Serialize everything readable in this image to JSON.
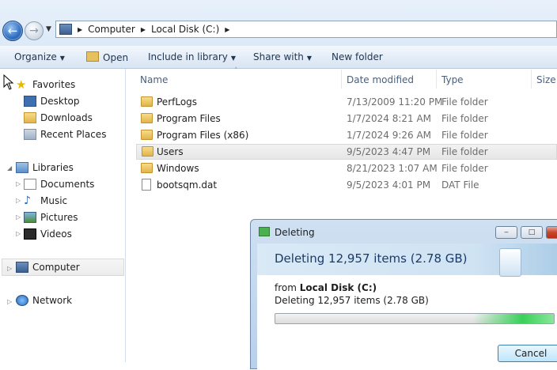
{
  "address_bar": {
    "crumbs": [
      "Computer",
      "Local Disk (C:)"
    ]
  },
  "toolbar": {
    "organize": "Organize",
    "open": "Open",
    "include_in_library": "Include in library",
    "share_with": "Share with",
    "new_folder": "New folder"
  },
  "nav": {
    "favorites": "Favorites",
    "desktop": "Desktop",
    "downloads": "Downloads",
    "recent_places": "Recent Places",
    "libraries": "Libraries",
    "documents": "Documents",
    "music": "Music",
    "pictures": "Pictures",
    "videos": "Videos",
    "computer": "Computer",
    "network": "Network"
  },
  "columns": {
    "name": "Name",
    "date_modified": "Date modified",
    "type": "Type",
    "size": "Size"
  },
  "files": [
    {
      "name": "PerfLogs",
      "date": "7/13/2009 11:20 PM",
      "type": "File folder",
      "icon": "folder-icon"
    },
    {
      "name": "Program Files",
      "date": "1/7/2024 8:21 AM",
      "type": "File folder",
      "icon": "folder-icon"
    },
    {
      "name": "Program Files (x86)",
      "date": "1/7/2024 9:26 AM",
      "type": "File folder",
      "icon": "folder-icon"
    },
    {
      "name": "Users",
      "date": "9/5/2023 4:47 PM",
      "type": "File folder",
      "icon": "folder-icon",
      "selected": true
    },
    {
      "name": "Windows",
      "date": "8/21/2023 1:07 AM",
      "type": "File folder",
      "icon": "folder-icon"
    },
    {
      "name": "bootsqm.dat",
      "date": "9/5/2023 4:01 PM",
      "type": "DAT File",
      "icon": "file-icon"
    }
  ],
  "dialog": {
    "title": "Deleting",
    "heading": "Deleting 12,957 items (2.78 GB)",
    "from_label": "from",
    "from_location": "Local Disk (C:)",
    "detail": "Deleting 12,957 items (2.78 GB)",
    "cancel": "Cancel"
  }
}
